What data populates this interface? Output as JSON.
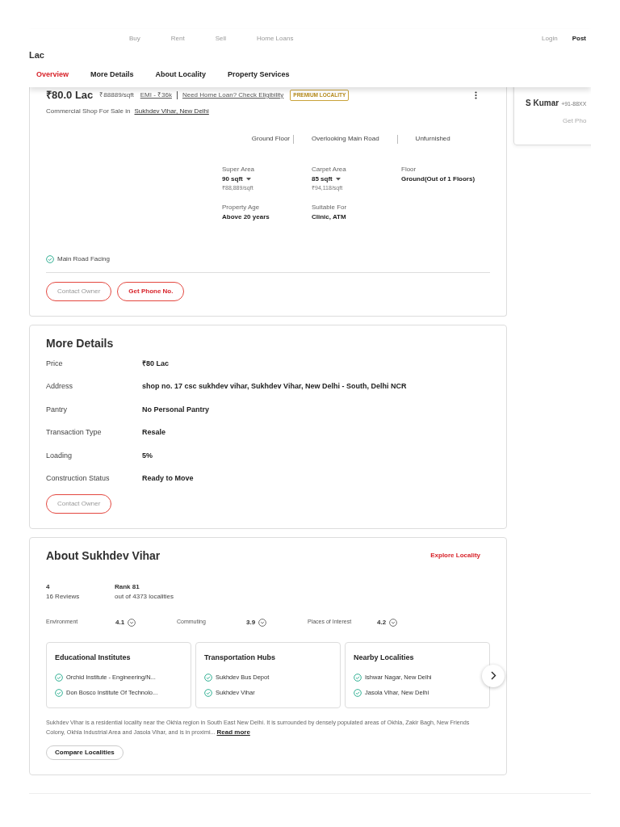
{
  "top_nav": {
    "links": [
      "Buy",
      "Rent",
      "Sell",
      "Home Loans"
    ],
    "login": "Login",
    "post": "Post"
  },
  "header_price": "Lac",
  "tabs": [
    {
      "label": "Overview",
      "selected": true
    },
    {
      "label": "More Details",
      "selected": false
    },
    {
      "label": "About Locality",
      "selected": false
    },
    {
      "label": "Property Services",
      "selected": false
    }
  ],
  "listing": {
    "price": "₹80.0 Lac",
    "rate": "₹88889/sqft",
    "emi": "EMI - ₹36k",
    "loan_link": "Need Home Loan? Check Eligibility",
    "badge": "PREMIUM LOCALITY",
    "subtitle": "Commercial Shop For Sale in",
    "locality_link": "Sukhdev Vihar, New Delhi",
    "highlights": [
      "Ground Floor",
      "Overlooking Main Road",
      "Unfurnished"
    ],
    "specs": [
      {
        "label": "Super Area",
        "value": "90 sqft",
        "dropdown": true,
        "sub": "₹88,889/sqft"
      },
      {
        "label": "Carpet Area",
        "value": "85 sqft",
        "dropdown": true,
        "sub": "₹94,118/sqft"
      },
      {
        "label": "Floor",
        "value": "Ground(Out of 1 Floors)",
        "dropdown": false
      },
      {
        "label": "Property Age",
        "value": "Above 20 years",
        "dropdown": false
      },
      {
        "label": "Suitable For",
        "value": "Clinic, ATM",
        "dropdown": false
      }
    ],
    "amenities": [
      "Main Road Facing"
    ],
    "buttons": [
      {
        "label": "Contact Owner",
        "kind": "outline"
      },
      {
        "label": "Get Phone No.",
        "kind": "primary"
      }
    ]
  },
  "contact_card": {
    "name": "S Kumar",
    "phone": "+91-88XX",
    "button": "Get Pho"
  },
  "more_details": {
    "title": "More Details",
    "rows": [
      {
        "label": "Price",
        "value": "₹80 Lac"
      },
      {
        "label": "Address",
        "value": "shop no. 17 csc sukhdev vihar, Sukhdev Vihar, New Delhi - South, Delhi NCR"
      },
      {
        "label": "Pantry",
        "value": "No Personal Pantry"
      },
      {
        "label": "Transaction Type",
        "value": "Resale"
      },
      {
        "label": "Loading",
        "value": "5%"
      },
      {
        "label": "Construction Status",
        "value": "Ready to Move"
      }
    ],
    "button": "Contact Owner"
  },
  "locality": {
    "title": "About Sukhdev Vihar",
    "explore": "Explore Locality",
    "rating": "4",
    "reviews": "16 Reviews",
    "rank": "Rank 81",
    "rank_sub": "out of 4373 localities",
    "ratings": [
      {
        "label": "Environment",
        "value": "4.1"
      },
      {
        "label": "Commuting",
        "value": "3.9"
      },
      {
        "label": "Places of Interest",
        "value": "4.2"
      }
    ],
    "groups": [
      {
        "title": "Educational Institutes",
        "items": [
          "Orchid Institute - Engineering/N...",
          "Don Bosco Institute Of Technolo..."
        ]
      },
      {
        "title": "Transportation Hubs",
        "items": [
          "Sukhdev Bus Depot",
          "Sukhdev Vihar"
        ]
      },
      {
        "title": "Nearby Localities",
        "items": [
          "Ishwar Nagar, New Delhi",
          "Jasola Vihar, New Delhi"
        ]
      }
    ],
    "description": "Sukhdev Vihar is a residential locality near the Okhla region in South East New Delhi. It is surrounded by densely populated areas of Okhla, Zakir Bagh, New Friends Colony, Okhla Industrial Area and Jasola Vihar, and is in proximi...",
    "read_more": "Read more",
    "compare": "Compare Localities"
  }
}
